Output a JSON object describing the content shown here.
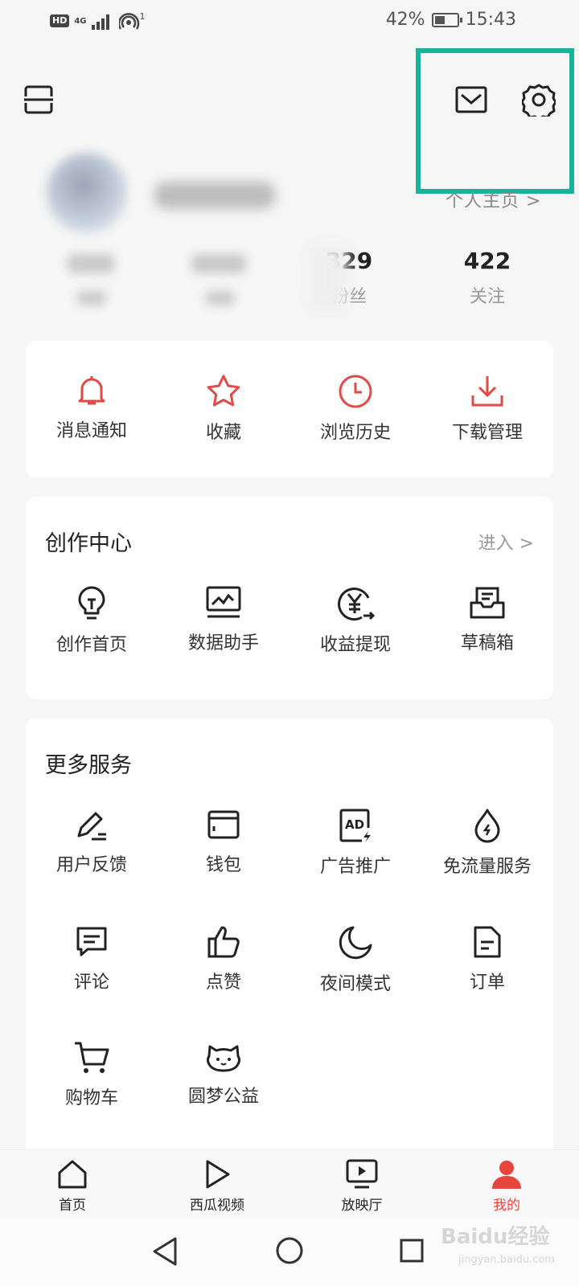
{
  "status_bar": {
    "network_badge": "HD",
    "network_type": "4G",
    "hotspot_count": "1",
    "battery_percent": "42%",
    "time": "15:43"
  },
  "profile": {
    "homepage_link": "个人主页 >"
  },
  "stats": [
    {
      "value": "329",
      "label": "粉丝"
    },
    {
      "value": "422",
      "label": "关注"
    }
  ],
  "quick_actions": [
    {
      "label": "消息通知",
      "icon": "bell-icon"
    },
    {
      "label": "收藏",
      "icon": "star-icon"
    },
    {
      "label": "浏览历史",
      "icon": "clock-icon"
    },
    {
      "label": "下载管理",
      "icon": "download-icon"
    }
  ],
  "creator_center": {
    "title": "创作中心",
    "enter_label": "进入 >",
    "items": [
      {
        "label": "创作首页",
        "icon": "lightbulb-icon"
      },
      {
        "label": "数据助手",
        "icon": "chart-monitor-icon"
      },
      {
        "label": "收益提现",
        "icon": "yuan-icon"
      },
      {
        "label": "草稿箱",
        "icon": "draft-box-icon"
      }
    ]
  },
  "more_services": {
    "title": "更多服务",
    "items": [
      {
        "label": "用户反馈",
        "icon": "pencil-icon"
      },
      {
        "label": "钱包",
        "icon": "wallet-icon"
      },
      {
        "label": "广告推广",
        "icon": "ad-icon"
      },
      {
        "label": "免流量服务",
        "icon": "drop-icon"
      },
      {
        "label": "评论",
        "icon": "comment-icon"
      },
      {
        "label": "点赞",
        "icon": "thumbs-up-icon"
      },
      {
        "label": "夜间模式",
        "icon": "moon-icon"
      },
      {
        "label": "订单",
        "icon": "order-icon"
      },
      {
        "label": "购物车",
        "icon": "cart-icon"
      },
      {
        "label": "圆梦公益",
        "icon": "cat-face-icon"
      }
    ]
  },
  "bottom_nav": [
    {
      "label": "首页",
      "icon": "home-icon"
    },
    {
      "label": "西瓜视频",
      "icon": "play-icon"
    },
    {
      "label": "放映厅",
      "icon": "tv-play-icon"
    },
    {
      "label": "我的",
      "icon": "person-icon",
      "active": true
    }
  ],
  "watermark": {
    "text": "Baidu经验",
    "sub": "jingyan.baidu.com"
  },
  "colors": {
    "accent": "#e8453c",
    "highlight": "#19b39b",
    "icon_red": "#e24a45"
  }
}
